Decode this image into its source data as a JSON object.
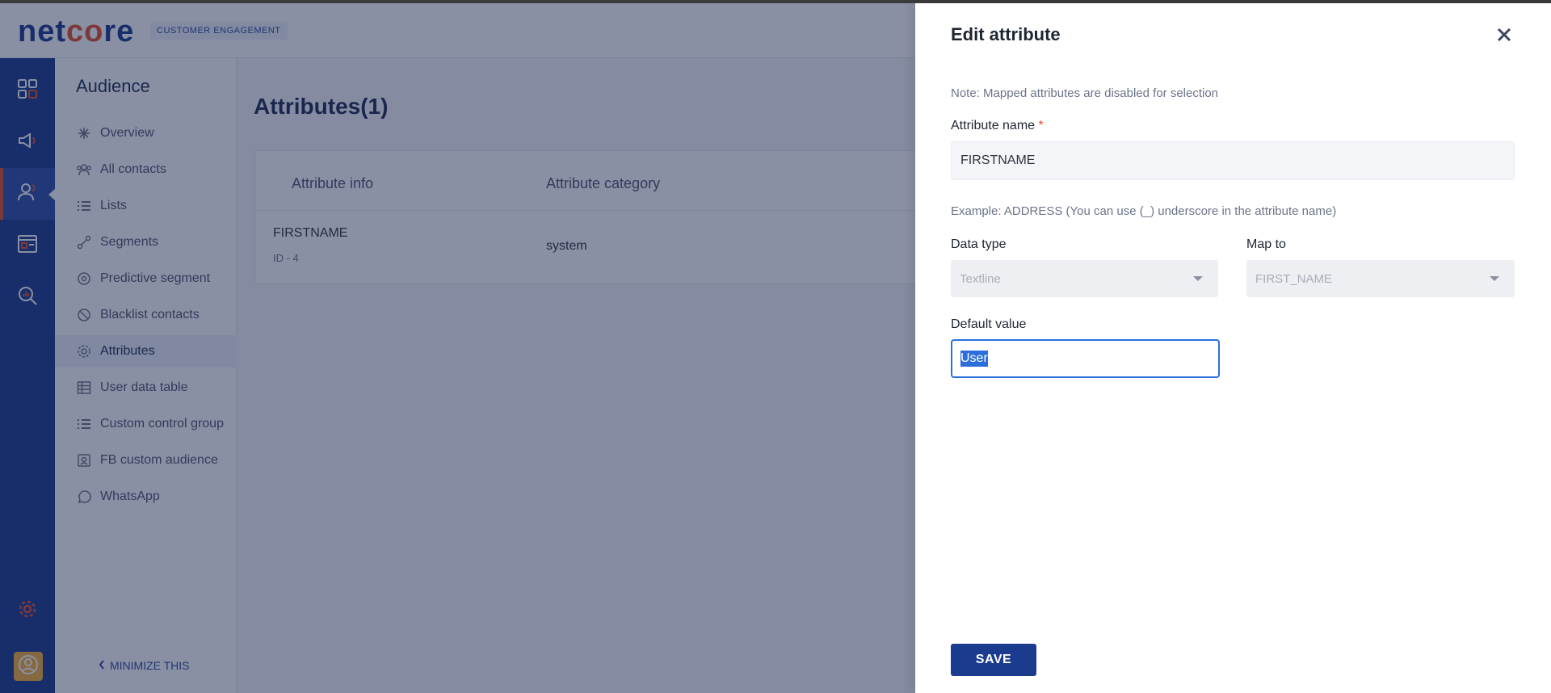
{
  "brand": {
    "logo_pre": "net",
    "logo_o": "co",
    "logo_post": "re",
    "tag": "CUSTOMER ENGAGEMENT"
  },
  "rail": {
    "items": [
      "dashboard-icon",
      "megaphone-icon",
      "audience-icon",
      "template-icon",
      "analytics-search-icon"
    ],
    "active_index": 2,
    "settings_icon": "gear-icon",
    "avatar_icon": "user-avatar-icon"
  },
  "submenu": {
    "title": "Audience",
    "items": [
      {
        "label": "Overview",
        "icon": "asterisk-icon"
      },
      {
        "label": "All contacts",
        "icon": "contacts-icon"
      },
      {
        "label": "Lists",
        "icon": "list-icon"
      },
      {
        "label": "Segments",
        "icon": "segments-icon"
      },
      {
        "label": "Predictive segment",
        "icon": "predictive-icon"
      },
      {
        "label": "Blacklist contacts",
        "icon": "blacklist-icon"
      },
      {
        "label": "Attributes",
        "icon": "attributes-icon"
      },
      {
        "label": "User data table",
        "icon": "table-icon"
      },
      {
        "label": "Custom control group",
        "icon": "list-icon"
      },
      {
        "label": "FB custom audience",
        "icon": "fb-audience-icon"
      },
      {
        "label": "WhatsApp",
        "icon": "whatsapp-icon"
      }
    ],
    "active_label": "Attributes",
    "minimize_label": "MINIMIZE THIS"
  },
  "main": {
    "title": "Attributes(1)",
    "columns": [
      "Attribute info",
      "Attribute category"
    ],
    "rows": [
      {
        "name": "FIRSTNAME",
        "id": "ID - 4",
        "category": "system"
      }
    ]
  },
  "drawer": {
    "title": "Edit attribute",
    "note": "Note: Mapped attributes are disabled for selection",
    "attribute_name_label": "Attribute name",
    "required_mark": "*",
    "attribute_name_value": "FIRSTNAME",
    "helper": "Example: ADDRESS (You can use (_) underscore in the attribute name)",
    "data_type_label": "Data type",
    "data_type_value": "Textline",
    "map_to_label": "Map to",
    "map_to_value": "FIRST_NAME",
    "default_value_label": "Default value",
    "default_value": "User",
    "save_label": "SAVE"
  },
  "colors": {
    "primary": "#1b3b8f",
    "accent": "#e5512a",
    "focus": "#2b6fdc"
  }
}
